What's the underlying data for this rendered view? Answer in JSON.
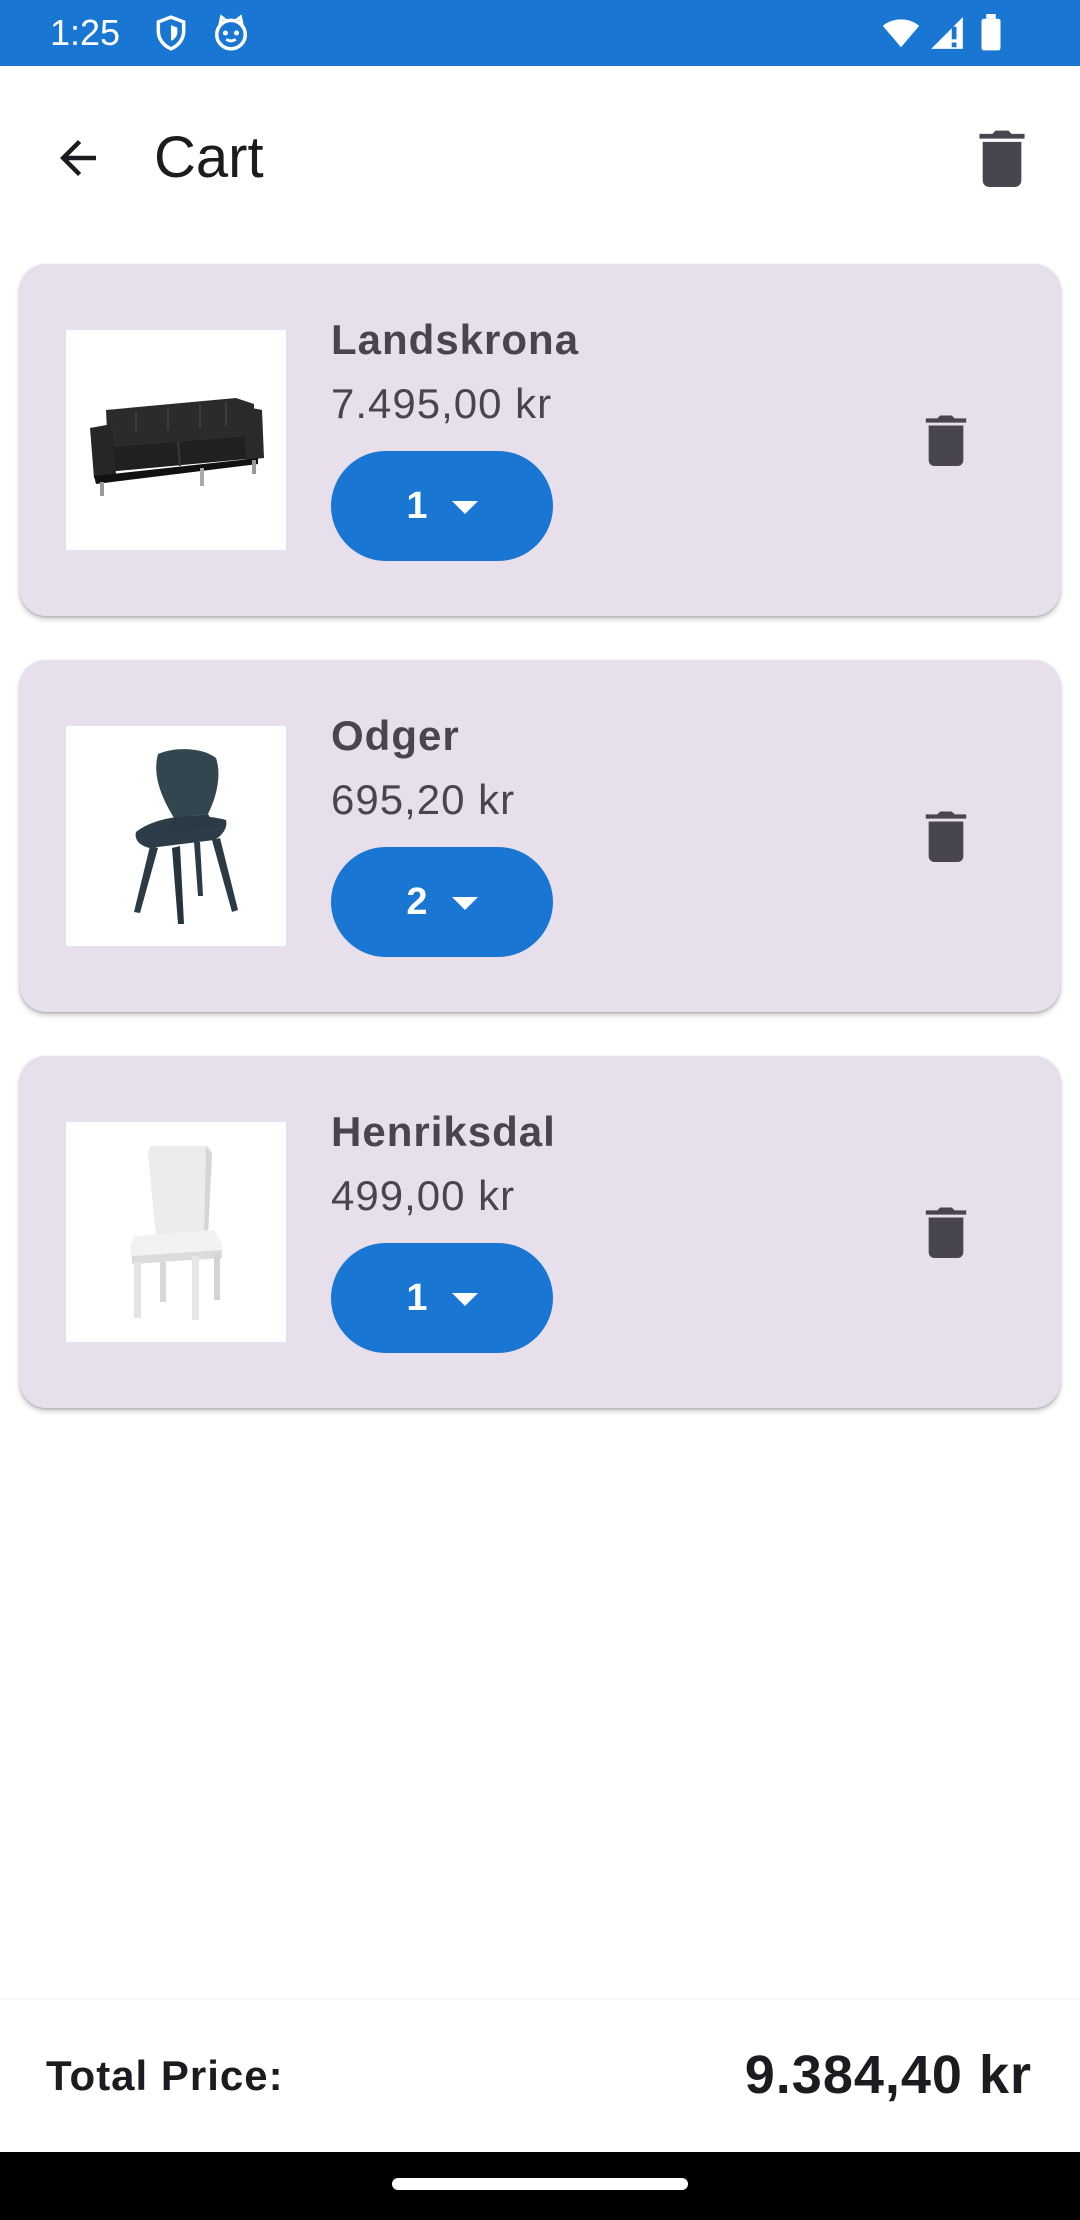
{
  "status_bar": {
    "time": "1:25",
    "background": "#1976d2",
    "icons": [
      "shield-icon",
      "cat-face-icon",
      "wifi-icon",
      "signal-icon",
      "battery-icon"
    ]
  },
  "app_bar": {
    "title": "Cart",
    "back_icon": "arrow-back-icon",
    "clear_icon": "trash-icon"
  },
  "cart": {
    "items": [
      {
        "name": "Landskrona",
        "price": "7.495,00 kr",
        "quantity": "1",
        "image": "sofa"
      },
      {
        "name": "Odger",
        "price": "695,20 kr",
        "quantity": "2",
        "image": "chair-blue"
      },
      {
        "name": "Henriksdal",
        "price": "499,00 kr",
        "quantity": "1",
        "image": "chair-white"
      }
    ]
  },
  "total": {
    "label": "Total Price:",
    "value": "9.384,40 kr"
  },
  "colors": {
    "accent": "#1976d2",
    "card_background": "#e7e0ec",
    "icon_dark": "#49454f"
  }
}
